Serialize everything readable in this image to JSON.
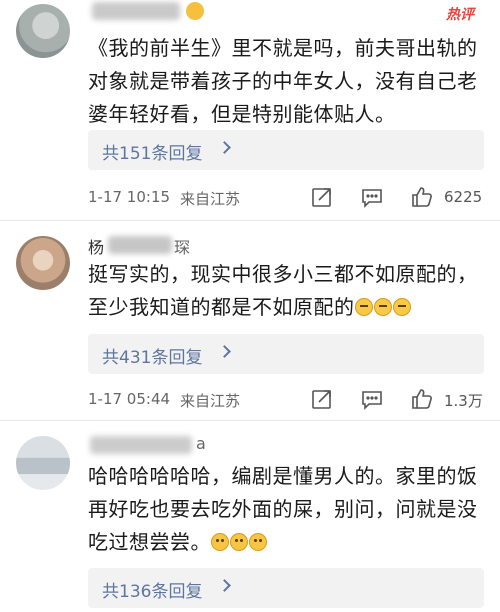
{
  "comments": [
    {
      "text": "《我的前半生》里不就是吗，前夫哥出轨的对象就是带着孩子的中年女人，没有自己老婆年轻好看，但是特别能体贴人。",
      "replies_label": "共151条回复",
      "time": "1-17 10:15",
      "source": "来自江苏",
      "likes": "6225",
      "badge": "热评"
    },
    {
      "username_visible": "杨",
      "username_tail": "琛",
      "text": "挺写实的，现实中很多小三都不如原配的，至少我知道的都是不如原配的",
      "replies_label": "共431条回复",
      "time": "1-17 05:44",
      "source": "来自江苏",
      "likes": "1.3万"
    },
    {
      "username_tail": "a",
      "text": "哈哈哈哈哈哈，编剧是懂男人的。家里的饭再好吃也要去吃外面的屎，别问，问就是没吃过想尝尝。",
      "replies_label": "共136条回复"
    }
  ],
  "icons": {
    "share": "share-icon",
    "comment": "comment-icon",
    "like": "thumbs-up-icon"
  }
}
